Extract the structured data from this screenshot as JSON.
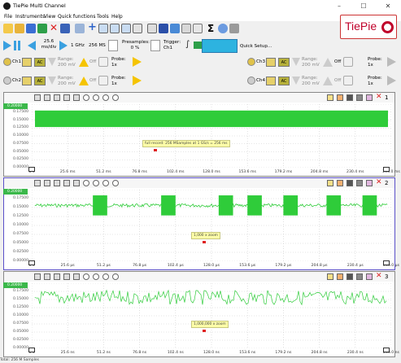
{
  "app": {
    "title": "TiePie Multi Channel",
    "logo_text": "TiePie"
  },
  "window_buttons": {
    "minimize": "–",
    "maximize": "☐",
    "close": "✕"
  },
  "menu": [
    "File",
    "Instruments",
    "View",
    "Quick functions",
    "Tools",
    "Help"
  ],
  "toolbar": {
    "timebase_value": "25.6",
    "timebase_unit": "ms/div",
    "sample_rate": "1 GHz",
    "record_length": "256 MS",
    "presamples_label": "Presamples:",
    "presamples_value": "0 %",
    "trigger_label": "Trigger:",
    "trigger_value": "Ch1",
    "quick_setup_label": "Quick Setup..."
  },
  "channels": [
    {
      "id": "Ch1",
      "range_label": "Range:",
      "range_value": "200 mV",
      "coupling": "AC",
      "off_label": "Off",
      "probe_label": "Probe:",
      "probe_value": "1x"
    },
    {
      "id": "Ch2",
      "range_label": "Range:",
      "range_value": "200 mV",
      "coupling": "AC",
      "off_label": "Off",
      "probe_label": "Probe:",
      "probe_value": "1x"
    },
    {
      "id": "Ch3",
      "range_label": "Range:",
      "range_value": "200 mV",
      "coupling": "AC",
      "off_label": "Off",
      "probe_label": "Probe:",
      "probe_value": "1x"
    },
    {
      "id": "Ch4",
      "range_label": "Range:",
      "range_value": "200 mV",
      "coupling": "AC",
      "off_label": "Off",
      "probe_label": "Probe:",
      "probe_value": "1x"
    }
  ],
  "scopes": [
    {
      "number": "1",
      "note": "full record: 256 MSamples at 1 GS/s = 256 ms",
      "y_labels": [
        "0.20000",
        "0.17500",
        "0.15000",
        "0.12500",
        "0.10000",
        "0.07500",
        "0.05000",
        "0.02500",
        "0.00000"
      ],
      "x_labels": [
        "0 s",
        "25.6 ms",
        "51.2 ms",
        "76.8 ms",
        "102.4 ms",
        "128.0 ms",
        "153.6 ms",
        "179.2 ms",
        "204.8 ms",
        "230.4 ms",
        "256.0 ms"
      ]
    },
    {
      "number": "2",
      "note": "1,000 x zoom",
      "y_labels": [
        "0.20000",
        "0.17500",
        "0.15000",
        "0.12500",
        "0.10000",
        "0.07500",
        "0.05000",
        "0.02500",
        "0.00000"
      ],
      "x_labels": [
        "0 s",
        "25.6 µs",
        "51.2 µs",
        "76.8 µs",
        "102.4 µs",
        "128.0 µs",
        "153.6 µs",
        "179.2 µs",
        "204.8 µs",
        "230.4 µs",
        "256.0 µs"
      ]
    },
    {
      "number": "3",
      "note": "1,000,000 x zoom",
      "y_labels": [
        "0.20000",
        "0.17500",
        "0.15000",
        "0.12500",
        "0.10000",
        "0.07500",
        "0.05000",
        "0.02500",
        "0.00000"
      ],
      "x_labels": [
        "0 s",
        "25.6 ns",
        "51.2 ns",
        "76.8 ns",
        "102.4 ns",
        "128.0 ns",
        "153.6 ns",
        "179.2 ns",
        "204.8 ns",
        "230.4 ns",
        "256.0 ns"
      ]
    }
  ],
  "statusbar": {
    "text": "Total: 256 M Samples"
  },
  "colors": {
    "signal": "#2fcc3a",
    "accent": "#c0002a",
    "select": "#5a4fc8"
  }
}
